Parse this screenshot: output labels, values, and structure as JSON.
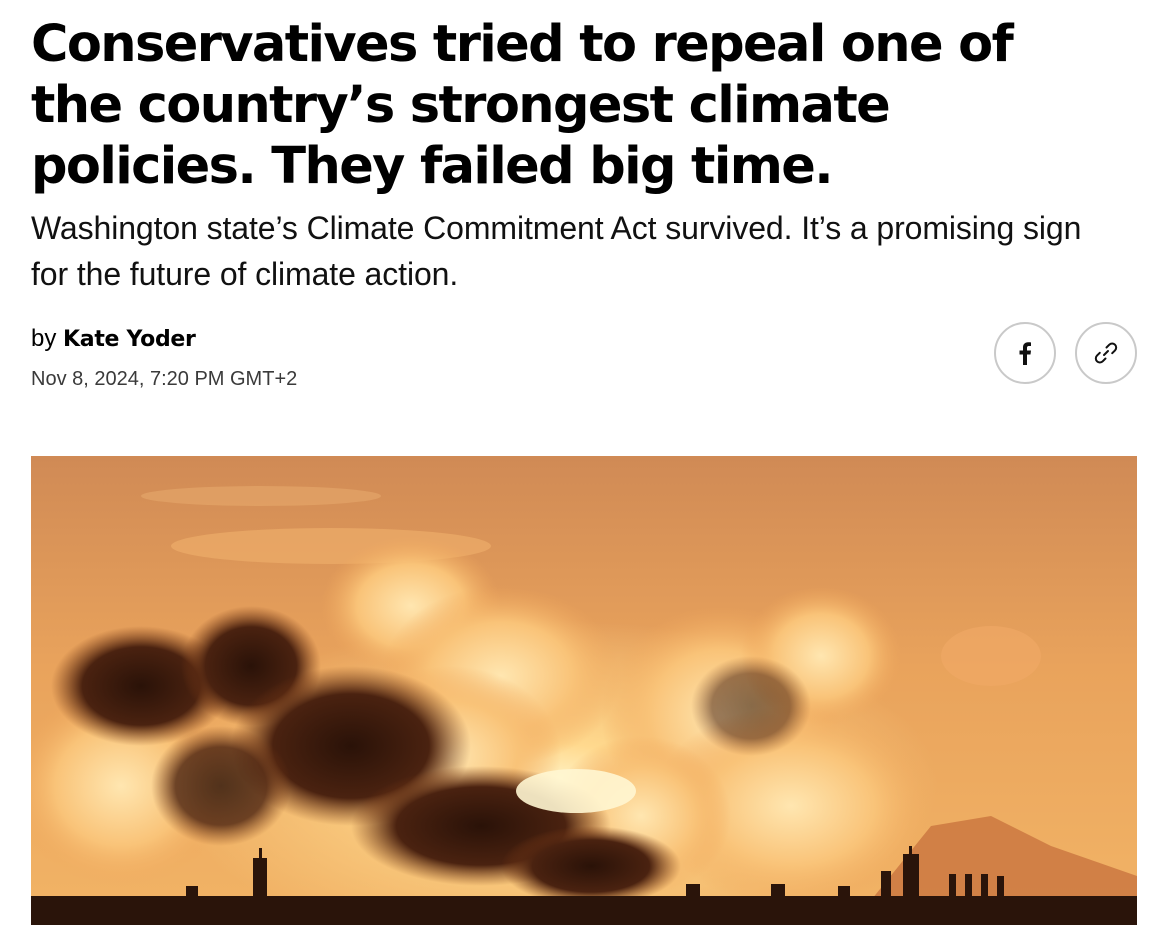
{
  "article": {
    "headline": "Conservatives tried to repeal one of the country’s strongest climate policies. They failed big time.",
    "dek": "Washington state’s Climate Commitment Act survived. It’s a promising sign for the future of climate action.",
    "byline_prefix": "by",
    "author": "Kate Yoder",
    "timestamp": "Nov 8, 2024, 7:20 PM GMT+2"
  },
  "share": {
    "buttons": [
      {
        "icon": "facebook-icon"
      },
      {
        "icon": "link-icon"
      }
    ]
  },
  "hero_image": {
    "subject": "industrial smokestacks billowing smoke against an orange sunset sky",
    "colors": {
      "sky_top": "#d9935a",
      "sky_glow": "#ffd28a",
      "smoke_dark": "#3a1a0c",
      "smoke_light": "#ffe0a8"
    }
  }
}
